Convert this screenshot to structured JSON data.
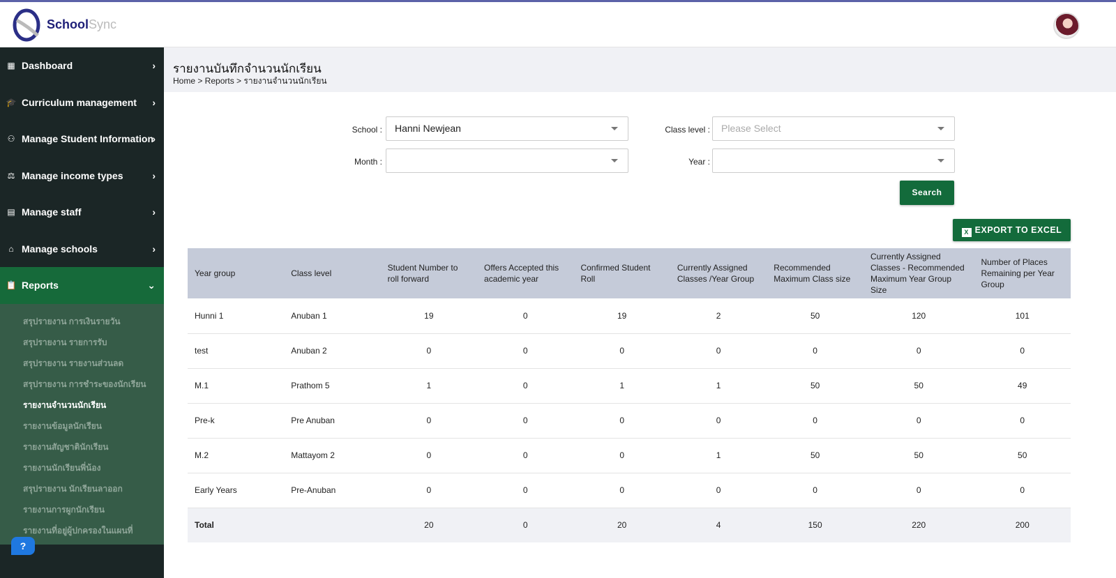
{
  "app": {
    "brand_main": "School",
    "brand_sub": "Sync"
  },
  "sidebar": {
    "items": [
      {
        "label": "Dashboard",
        "icon": "grid-icon"
      },
      {
        "label": "Curriculum management",
        "icon": "graduation-cap-icon"
      },
      {
        "label": "Manage Student Information",
        "icon": "student-icon"
      },
      {
        "label": "Manage income types",
        "icon": "money-icon"
      },
      {
        "label": "Manage staff",
        "icon": "staff-icon"
      },
      {
        "label": "Manage schools",
        "icon": "school-icon"
      },
      {
        "label": "Reports",
        "icon": "clipboard-icon"
      }
    ],
    "sub_items": [
      "สรุปรายงาน การเงินรายวัน",
      "สรุปรายงาน รายการรับ",
      "สรุปรายงาน รายงานส่วนลด",
      "สรุปรายงาน การชำระของนักเรียน",
      "รายงานจำนวนนักเรียน",
      "รายงานข้อมูลนักเรียน",
      "รายงานสัญชาตินักเรียน",
      "รายงานนักเรียนพี่น้อง",
      "สรุปรายงาน นักเรียนลาออก",
      "รายงานการผูกนักเรียน",
      "รายงานที่อยู่ผู้ปกครองในแผนที่"
    ],
    "active_sub": 4
  },
  "page": {
    "title": "รายงานบันทึกจำนวนนักเรียน",
    "breadcrumb": "Home > Reports > รายงานจำนวนนักเรียน"
  },
  "filters": {
    "school_label": "School :",
    "school_value": "Hanni Newjean",
    "class_label": "Class level :",
    "class_placeholder": "Please Select",
    "month_label": "Month :",
    "month_value": "",
    "year_label": "Year :",
    "year_value": "",
    "search": "Search",
    "export": "EXPORT TO EXCEL"
  },
  "table": {
    "headers": [
      "Year group",
      "Class level",
      "Student Number to roll forward",
      "Offers Accepted this academic year",
      "Confirmed Student Roll",
      "Currently Assigned Classes /Year Group",
      "Recommended Maximum Class size",
      "Currently Assigned Classes - Recommended Maximum Year Group Size",
      "Number of Places Remaining per Year Group"
    ],
    "rows": [
      [
        "Hunni 1",
        "Anuban 1",
        "19",
        "0",
        "19",
        "2",
        "50",
        "120",
        "101"
      ],
      [
        "test",
        "Anuban 2",
        "0",
        "0",
        "0",
        "0",
        "0",
        "0",
        "0"
      ],
      [
        "M.1",
        "Prathom 5",
        "1",
        "0",
        "1",
        "1",
        "50",
        "50",
        "49"
      ],
      [
        "Pre-k",
        "Pre Anuban",
        "0",
        "0",
        "0",
        "0",
        "0",
        "0",
        "0"
      ],
      [
        "M.2",
        "Mattayom 2",
        "0",
        "0",
        "0",
        "1",
        "50",
        "50",
        "50"
      ],
      [
        "Early Years",
        "Pre-Anuban",
        "0",
        "0",
        "0",
        "0",
        "0",
        "0",
        "0"
      ]
    ],
    "total": [
      "Total",
      "",
      "20",
      "0",
      "20",
      "4",
      "150",
      "220",
      "200"
    ]
  },
  "colors": {
    "sidebar": "#1b2626",
    "active": "#166a3a",
    "submenu": "#365c48",
    "button": "#136b3b",
    "table_header": "#c5cbd9"
  }
}
